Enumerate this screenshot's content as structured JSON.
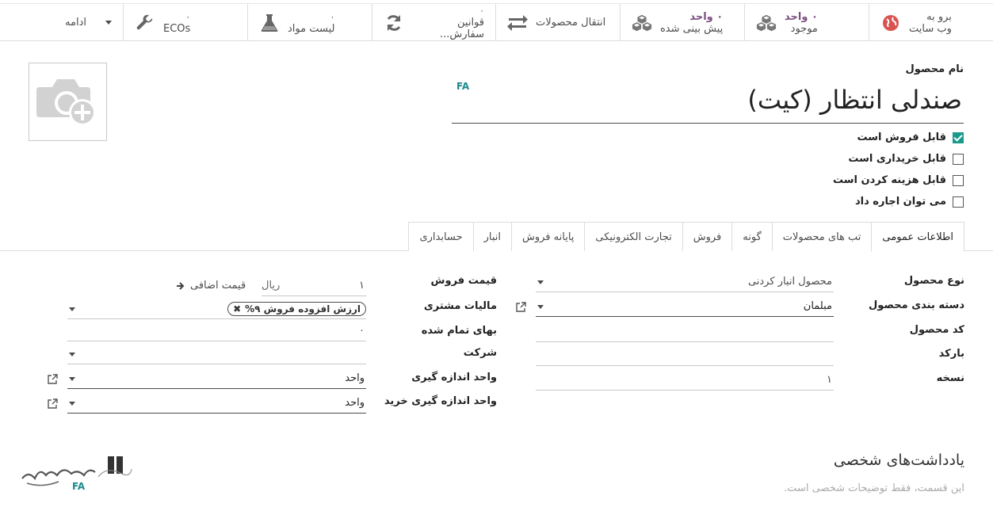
{
  "smart_buttons": [
    {
      "id": "website",
      "icon": "globe-icon",
      "line1": "برو به",
      "line2": "وب سایت",
      "value": ""
    },
    {
      "id": "on_hand",
      "icon": "cubes-icon",
      "value": "۰ واحد",
      "line2": "موجود"
    },
    {
      "id": "forecasted",
      "icon": "cubes-icon",
      "value": "۰ واحد",
      "line2": "پیش بینی شده"
    },
    {
      "id": "moves",
      "icon": "arrows-exchange-icon",
      "line1": "انتقال محصولات",
      "value": ""
    },
    {
      "id": "reordering",
      "icon": "refresh-icon",
      "count": "۰",
      "line2": "قوانین سفارش..."
    },
    {
      "id": "bom",
      "icon": "flask-icon",
      "count": "۰",
      "line2": "لیست مواد"
    },
    {
      "id": "ecos",
      "icon": "wrench-icon",
      "count": "۰",
      "line2": "ECOs"
    }
  ],
  "more_label": "ادامه",
  "product": {
    "name_label": "نام محصول",
    "name": "صندلی انتظار (کیت)",
    "lang_badge": "FA"
  },
  "checkboxes": [
    {
      "label": "قابل فروش است",
      "checked": true
    },
    {
      "label": "قابل خریداری است",
      "checked": false
    },
    {
      "label": "قابل هزینه کردن است",
      "checked": false
    },
    {
      "label": "می توان اجاره داد",
      "checked": false
    }
  ],
  "tabs": [
    "اطلاعات عمومی",
    "تب های محصولات",
    "گونه",
    "فروش",
    "تجارت الکترونیکی",
    "پایانه فروش",
    "انبار",
    "حسابداری"
  ],
  "right_fields": {
    "product_type": {
      "label": "نوع محصول",
      "value": "محصول انبار کردنی"
    },
    "category": {
      "label": "دسته بندی محصول",
      "value": "مبلمان"
    },
    "code": {
      "label": "کد محصول",
      "value": ""
    },
    "barcode": {
      "label": "بارکد",
      "value": ""
    },
    "version": {
      "label": "نسخه",
      "value": "۱"
    }
  },
  "left_fields": {
    "sale_price": {
      "label": "قیمت فروش",
      "value": "۱",
      "currency": "ریال",
      "extra": "قیمت اضافی"
    },
    "customer_taxes": {
      "label": "مالیات مشتری",
      "tag": "ارزش افزوده فروش ۹%"
    },
    "cost": {
      "label": "بهای تمام شده",
      "value": "۰"
    },
    "company": {
      "label": "شرکت",
      "value": ""
    },
    "uom": {
      "label": "واحد اندازه گیری",
      "value": "واحد"
    },
    "purchase_uom": {
      "label": "واحد اندازه گیری خرید",
      "value": "واحد"
    }
  },
  "notes": {
    "title": "یادداشت‌های شخصی",
    "placeholder": "این قسمت، فقط توضیحات شخصی است."
  },
  "watermark": {
    "text": "تشهیرگستر",
    "badge": "FA"
  }
}
